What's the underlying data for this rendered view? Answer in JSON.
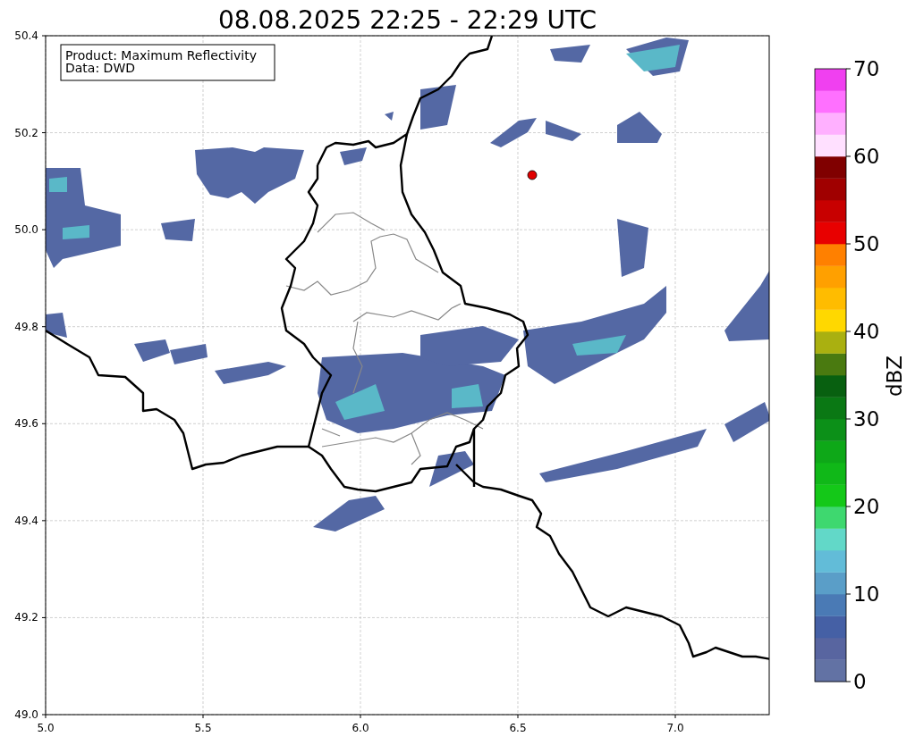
{
  "title": "08.08.2025 22:25 - 22:29 UTC",
  "legend": [
    "Product: Maximum Reflectivity",
    "Data: DWD"
  ],
  "x_ticks": [
    "5.0",
    "5.5",
    "6.0",
    "6.5",
    "7.0"
  ],
  "y_ticks": [
    "50.4",
    "50.2",
    "50.0",
    "49.8",
    "49.6",
    "49.4",
    "49.2",
    "49.0"
  ],
  "colorbar": {
    "label": "dBZ",
    "ticks": [
      "70",
      "60",
      "50",
      "40",
      "30",
      "20",
      "10",
      "0"
    ],
    "segments": [
      {
        "color": "#6272a4"
      },
      {
        "color": "#5865a0"
      },
      {
        "color": "#4560a5"
      },
      {
        "color": "#4a7ab5"
      },
      {
        "color": "#5a9ec8"
      },
      {
        "color": "#62bcd8"
      },
      {
        "color": "#62d8c8"
      },
      {
        "color": "#3ed86f"
      },
      {
        "color": "#14c818"
      },
      {
        "color": "#10b818"
      },
      {
        "color": "#0ea818"
      },
      {
        "color": "#0c9018"
      },
      {
        "color": "#0a7814"
      },
      {
        "color": "#086010"
      },
      {
        "color": "#4a7a10"
      },
      {
        "color": "#aab010"
      },
      {
        "color": "#ffd800"
      },
      {
        "color": "#ffbc00"
      },
      {
        "color": "#ffa000"
      },
      {
        "color": "#ff8000"
      },
      {
        "color": "#e80000"
      },
      {
        "color": "#c80000"
      },
      {
        "color": "#a00000"
      },
      {
        "color": "#800000"
      },
      {
        "color": "#ffe0ff"
      },
      {
        "color": "#ffb0ff"
      },
      {
        "color": "#ff70ff"
      },
      {
        "color": "#f040f0"
      }
    ]
  }
}
